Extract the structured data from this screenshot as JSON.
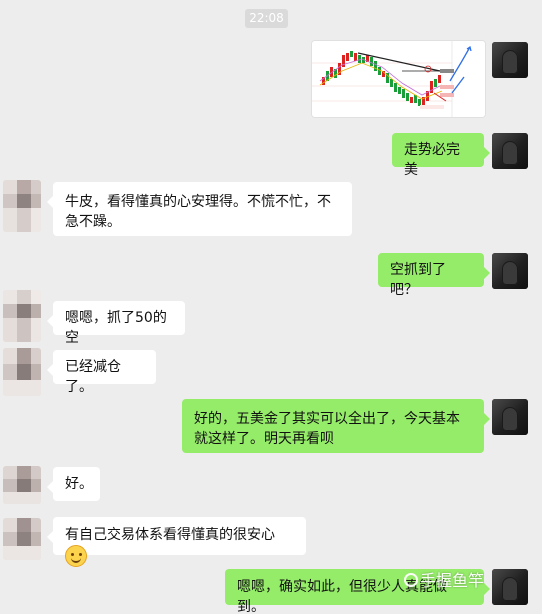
{
  "timestamp": "22:08",
  "messages": [
    {
      "side": "right",
      "type": "image",
      "content": "chart-screenshot"
    },
    {
      "side": "right",
      "type": "text",
      "text": "走势必完美"
    },
    {
      "side": "left",
      "type": "text",
      "text": "牛皮，看得懂真的心安理得。不慌不忙，不急不躁。"
    },
    {
      "side": "right",
      "type": "text",
      "text": "空抓到了吧？"
    },
    {
      "side": "left",
      "type": "text",
      "text": "嗯嗯，抓了50的空"
    },
    {
      "side": "left",
      "type": "text",
      "text": "已经减仓了。"
    },
    {
      "side": "right",
      "type": "text",
      "text": "好的，五美金了其实可以全出了，今天基本就这样了。明天再看呗"
    },
    {
      "side": "left",
      "type": "text",
      "text": "好。"
    },
    {
      "side": "left",
      "type": "text",
      "text": "有自己交易体系看得懂真的很安心",
      "emoji": "smile-emoji"
    },
    {
      "side": "right",
      "type": "text",
      "text": "嗯嗯，确实如此，但很少人真能做到。"
    }
  ],
  "watermark": {
    "text": "手握鱼竿",
    "icon": "at-icon"
  },
  "colors": {
    "background": "#ededed",
    "self_bubble": "#95ec69",
    "other_bubble": "#ffffff",
    "time_pill": "#dadada"
  }
}
